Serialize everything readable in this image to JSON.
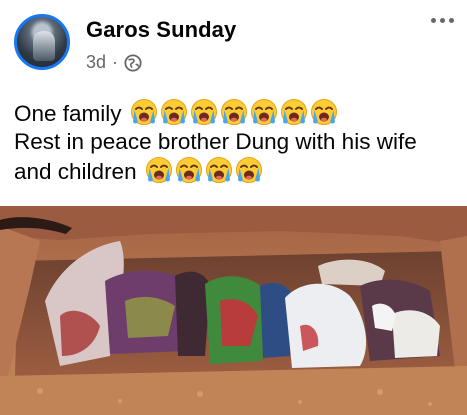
{
  "post": {
    "author": "Garos Sunday",
    "time": "3d",
    "separator": "·",
    "audience_icon": "globe-icon",
    "more_icon": "more-options-icon",
    "text_line1": "One family",
    "text_line2": "Rest in peace brother Dung with his wife",
    "text_line3": "and children",
    "emoji_name": "loudly-crying-face",
    "emoji_count_line1": 7,
    "emoji_count_line3": 4,
    "colors": {
      "avatar_ring": "#1877f2",
      "meta_text": "#65676b",
      "soil": "#b9754e"
    }
  }
}
